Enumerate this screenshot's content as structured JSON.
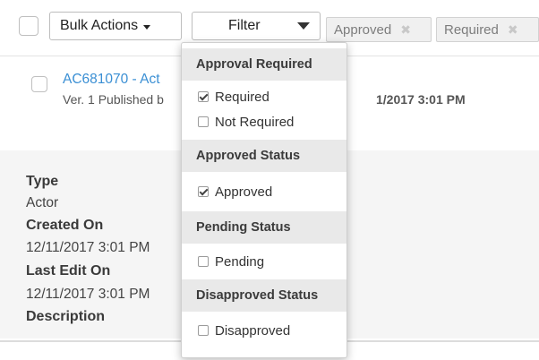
{
  "toolbar": {
    "bulk_actions_label": "Bulk Actions",
    "filter_label": "Filter",
    "active_filters": [
      {
        "label": "Approved",
        "remove_icon": "close-icon"
      },
      {
        "label": "Required",
        "remove_icon": "close-icon"
      }
    ]
  },
  "list": {
    "item_title": "AC681070 - Act",
    "item_subtitle_left": "Ver. 1 Published b",
    "item_subtitle_right": "1/2017 3:01 PM"
  },
  "details": {
    "type_label": "Type",
    "type_value": "Actor",
    "created_label": "Created On",
    "created_value": "12/11/2017 3:01 PM",
    "edited_label": "Last Edit On",
    "edited_value": "12/11/2017 3:01 PM",
    "description_label": "Description"
  },
  "filter_menu": {
    "sections": [
      {
        "title": "Approval Required",
        "options": [
          {
            "label": "Required",
            "checked": true
          },
          {
            "label": "Not Required",
            "checked": false
          }
        ]
      },
      {
        "title": "Approved Status",
        "options": [
          {
            "label": "Approved",
            "checked": true
          }
        ]
      },
      {
        "title": "Pending Status",
        "options": [
          {
            "label": "Pending",
            "checked": false
          }
        ]
      },
      {
        "title": "Disapproved Status",
        "options": [
          {
            "label": "Disapproved",
            "checked": false
          }
        ]
      }
    ]
  },
  "colors": {
    "link": "#3a8fd4",
    "header_bg": "#e9e9e9",
    "detail_bg": "#f5f5f5"
  }
}
